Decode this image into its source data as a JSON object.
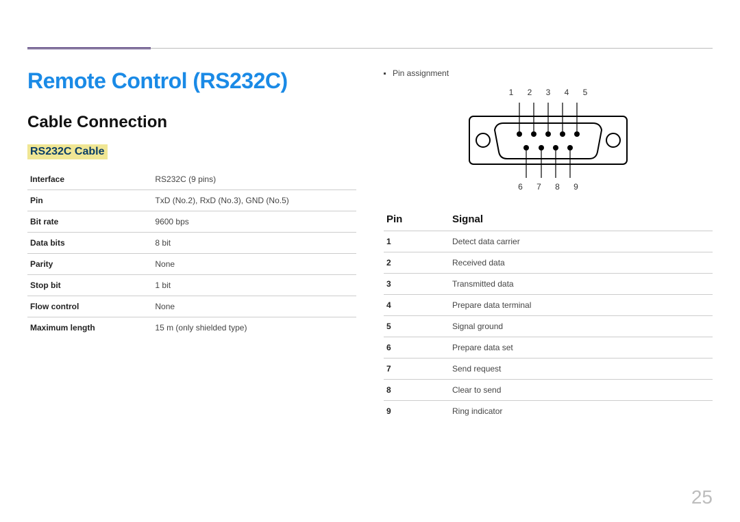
{
  "page_number": "25",
  "headings": {
    "title": "Remote Control (RS232C)",
    "subsection": "Cable Connection",
    "cable_label": "RS232C Cable"
  },
  "cable_specs": [
    {
      "key": "Interface",
      "val": "RS232C (9 pins)"
    },
    {
      "key": "Pin",
      "val": "TxD (No.2), RxD (No.3), GND (No.5)"
    },
    {
      "key": "Bit rate",
      "val": "9600 bps"
    },
    {
      "key": "Data bits",
      "val": "8 bit"
    },
    {
      "key": "Parity",
      "val": "None"
    },
    {
      "key": "Stop bit",
      "val": "1 bit"
    },
    {
      "key": "Flow control",
      "val": "None"
    },
    {
      "key": "Maximum length",
      "val": "15 m (only shielded type)"
    }
  ],
  "right_col": {
    "bullet": "Pin assignment",
    "top_pins": [
      "1",
      "2",
      "3",
      "4",
      "5"
    ],
    "bottom_pins": [
      "6",
      "7",
      "8",
      "9"
    ],
    "pin_table_header": {
      "pin": "Pin",
      "signal": "Signal"
    },
    "pin_table": [
      {
        "pin": "1",
        "signal": "Detect data carrier"
      },
      {
        "pin": "2",
        "signal": "Received data"
      },
      {
        "pin": "3",
        "signal": "Transmitted data"
      },
      {
        "pin": "4",
        "signal": "Prepare data terminal"
      },
      {
        "pin": "5",
        "signal": "Signal ground"
      },
      {
        "pin": "6",
        "signal": "Prepare data set"
      },
      {
        "pin": "7",
        "signal": "Send request"
      },
      {
        "pin": "8",
        "signal": "Clear to send"
      },
      {
        "pin": "9",
        "signal": "Ring indicator"
      }
    ]
  }
}
